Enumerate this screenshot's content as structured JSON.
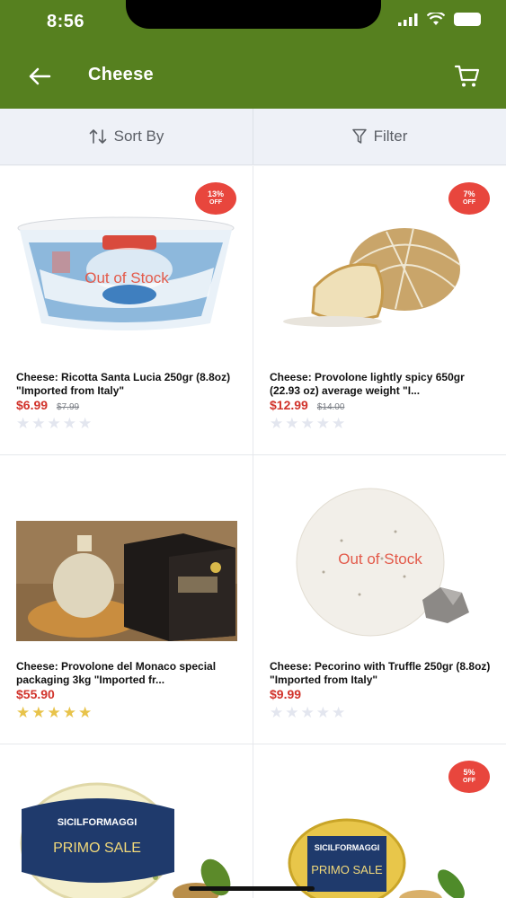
{
  "status_bar": {
    "time": "8:56"
  },
  "header": {
    "title": "Cheese"
  },
  "toolbar": {
    "sort_label": "Sort By",
    "filter_label": "Filter"
  },
  "products": [
    {
      "name": "Cheese: Ricotta Santa Lucia 250gr (8.8oz) \"Imported from Italy\"",
      "price": "$6.99",
      "old_price": "$7.99",
      "badge_percent": "13%",
      "badge_off": "OFF",
      "overlay": "Out of Stock",
      "rating": 0
    },
    {
      "name": "Cheese: Provolone lightly spicy 650gr (22.93 oz) average weight \"I...",
      "price": "$12.99",
      "old_price": "$14.00",
      "badge_percent": "7%",
      "badge_off": "OFF",
      "overlay": "",
      "rating": 0
    },
    {
      "name": "Cheese: Provolone del Monaco special packaging 3kg \"Imported fr...",
      "price": "$55.90",
      "old_price": "",
      "badge_percent": "",
      "badge_off": "",
      "overlay": "",
      "rating": 5
    },
    {
      "name": "Cheese: Pecorino with Truffle 250gr (8.8oz) \"Imported from Italy\"",
      "price": "$9.99",
      "old_price": "",
      "badge_percent": "",
      "badge_off": "",
      "overlay": "Out of Stock",
      "rating": 0
    },
    {
      "brand_text": "SICILFORMAGGI",
      "label_text": "PRIMO SALE",
      "badge_percent": "",
      "badge_off": ""
    },
    {
      "brand_text": "SICILFORMAGGI",
      "label_text": "PRIMO SALE",
      "badge_percent": "5%",
      "badge_off": "OFF"
    }
  ],
  "colors": {
    "header": "#56801f",
    "badge": "#e8463d",
    "price": "#d1332b",
    "star": "#e8c34a"
  }
}
